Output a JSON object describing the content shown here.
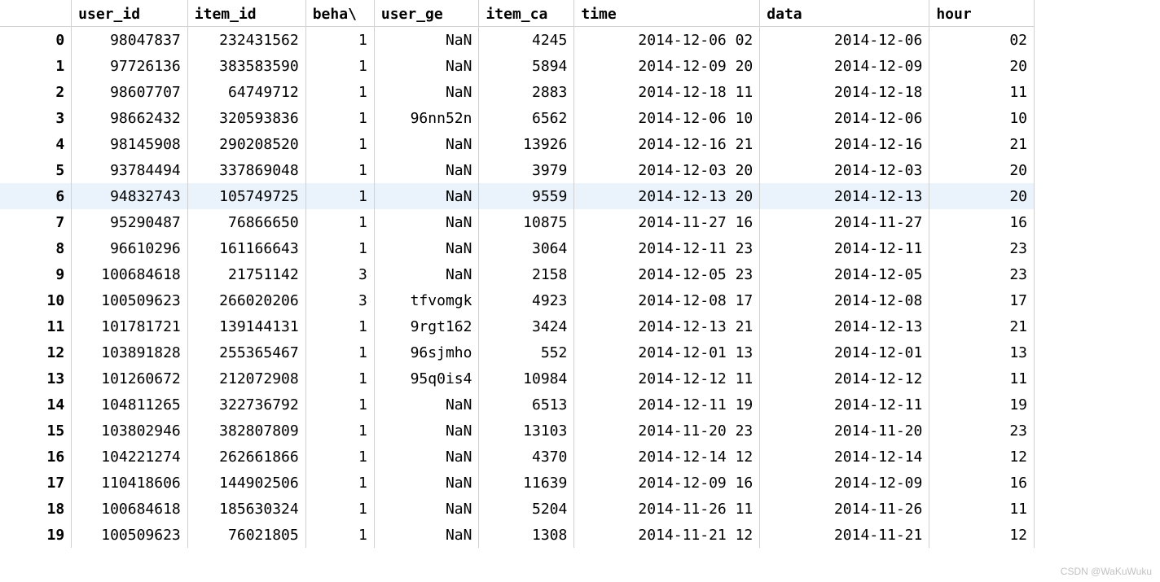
{
  "columns": [
    "user_id",
    "item_id",
    "beha\\",
    "user_ge",
    "item_ca",
    "time",
    "data",
    "hour"
  ],
  "highlight_row": 6,
  "rows": [
    {
      "idx": "0",
      "user_id": "98047837",
      "item_id": "232431562",
      "beha": "1",
      "user_ge": "NaN",
      "item_ca": "4245",
      "time": "2014-12-06 02",
      "data": "2014-12-06",
      "hour": "02"
    },
    {
      "idx": "1",
      "user_id": "97726136",
      "item_id": "383583590",
      "beha": "1",
      "user_ge": "NaN",
      "item_ca": "5894",
      "time": "2014-12-09 20",
      "data": "2014-12-09",
      "hour": "20"
    },
    {
      "idx": "2",
      "user_id": "98607707",
      "item_id": "64749712",
      "beha": "1",
      "user_ge": "NaN",
      "item_ca": "2883",
      "time": "2014-12-18 11",
      "data": "2014-12-18",
      "hour": "11"
    },
    {
      "idx": "3",
      "user_id": "98662432",
      "item_id": "320593836",
      "beha": "1",
      "user_ge": "96nn52n",
      "item_ca": "6562",
      "time": "2014-12-06 10",
      "data": "2014-12-06",
      "hour": "10"
    },
    {
      "idx": "4",
      "user_id": "98145908",
      "item_id": "290208520",
      "beha": "1",
      "user_ge": "NaN",
      "item_ca": "13926",
      "time": "2014-12-16 21",
      "data": "2014-12-16",
      "hour": "21"
    },
    {
      "idx": "5",
      "user_id": "93784494",
      "item_id": "337869048",
      "beha": "1",
      "user_ge": "NaN",
      "item_ca": "3979",
      "time": "2014-12-03 20",
      "data": "2014-12-03",
      "hour": "20"
    },
    {
      "idx": "6",
      "user_id": "94832743",
      "item_id": "105749725",
      "beha": "1",
      "user_ge": "NaN",
      "item_ca": "9559",
      "time": "2014-12-13 20",
      "data": "2014-12-13",
      "hour": "20"
    },
    {
      "idx": "7",
      "user_id": "95290487",
      "item_id": "76866650",
      "beha": "1",
      "user_ge": "NaN",
      "item_ca": "10875",
      "time": "2014-11-27 16",
      "data": "2014-11-27",
      "hour": "16"
    },
    {
      "idx": "8",
      "user_id": "96610296",
      "item_id": "161166643",
      "beha": "1",
      "user_ge": "NaN",
      "item_ca": "3064",
      "time": "2014-12-11 23",
      "data": "2014-12-11",
      "hour": "23"
    },
    {
      "idx": "9",
      "user_id": "100684618",
      "item_id": "21751142",
      "beha": "3",
      "user_ge": "NaN",
      "item_ca": "2158",
      "time": "2014-12-05 23",
      "data": "2014-12-05",
      "hour": "23"
    },
    {
      "idx": "10",
      "user_id": "100509623",
      "item_id": "266020206",
      "beha": "3",
      "user_ge": "tfvomgk",
      "item_ca": "4923",
      "time": "2014-12-08 17",
      "data": "2014-12-08",
      "hour": "17"
    },
    {
      "idx": "11",
      "user_id": "101781721",
      "item_id": "139144131",
      "beha": "1",
      "user_ge": "9rgt162",
      "item_ca": "3424",
      "time": "2014-12-13 21",
      "data": "2014-12-13",
      "hour": "21"
    },
    {
      "idx": "12",
      "user_id": "103891828",
      "item_id": "255365467",
      "beha": "1",
      "user_ge": "96sjmho",
      "item_ca": "552",
      "time": "2014-12-01 13",
      "data": "2014-12-01",
      "hour": "13"
    },
    {
      "idx": "13",
      "user_id": "101260672",
      "item_id": "212072908",
      "beha": "1",
      "user_ge": "95q0is4",
      "item_ca": "10984",
      "time": "2014-12-12 11",
      "data": "2014-12-12",
      "hour": "11"
    },
    {
      "idx": "14",
      "user_id": "104811265",
      "item_id": "322736792",
      "beha": "1",
      "user_ge": "NaN",
      "item_ca": "6513",
      "time": "2014-12-11 19",
      "data": "2014-12-11",
      "hour": "19"
    },
    {
      "idx": "15",
      "user_id": "103802946",
      "item_id": "382807809",
      "beha": "1",
      "user_ge": "NaN",
      "item_ca": "13103",
      "time": "2014-11-20 23",
      "data": "2014-11-20",
      "hour": "23"
    },
    {
      "idx": "16",
      "user_id": "104221274",
      "item_id": "262661866",
      "beha": "1",
      "user_ge": "NaN",
      "item_ca": "4370",
      "time": "2014-12-14 12",
      "data": "2014-12-14",
      "hour": "12"
    },
    {
      "idx": "17",
      "user_id": "110418606",
      "item_id": "144902506",
      "beha": "1",
      "user_ge": "NaN",
      "item_ca": "11639",
      "time": "2014-12-09 16",
      "data": "2014-12-09",
      "hour": "16"
    },
    {
      "idx": "18",
      "user_id": "100684618",
      "item_id": "185630324",
      "beha": "1",
      "user_ge": "NaN",
      "item_ca": "5204",
      "time": "2014-11-26 11",
      "data": "2014-11-26",
      "hour": "11"
    },
    {
      "idx": "19",
      "user_id": "100509623",
      "item_id": "76021805",
      "beha": "1",
      "user_ge": "NaN",
      "item_ca": "1308",
      "time": "2014-11-21 12",
      "data": "2014-11-21",
      "hour": "12"
    }
  ],
  "watermark": "CSDN @WaKuWuku"
}
